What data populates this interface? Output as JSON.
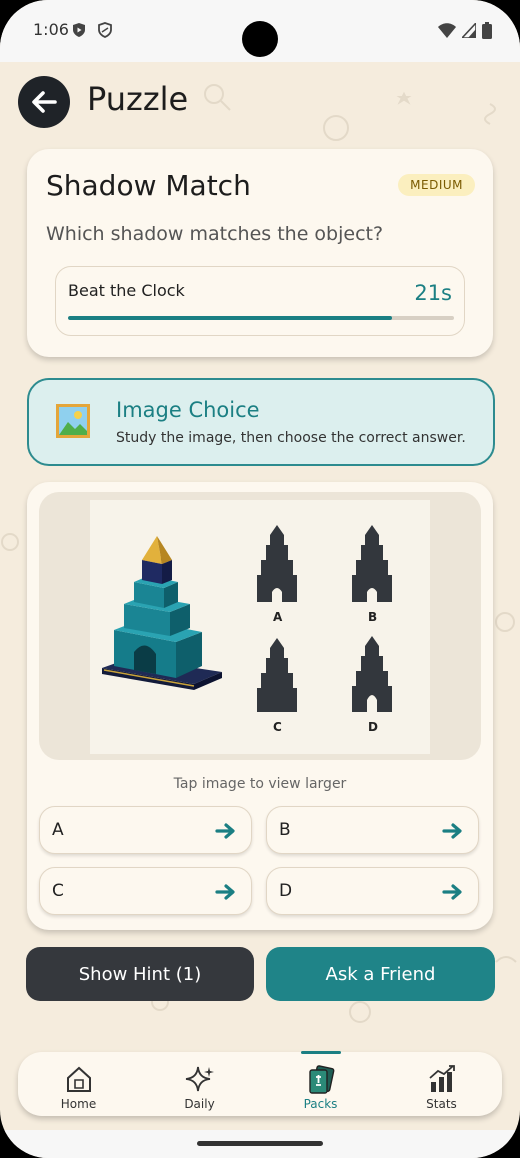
{
  "status": {
    "time": "1:06"
  },
  "header": {
    "title": "Puzzle"
  },
  "puzzle": {
    "title": "Shadow Match",
    "difficulty": "MEDIUM",
    "question": "Which shadow matches the object?"
  },
  "timer": {
    "label": "Beat the Clock",
    "value": "21s",
    "progress": 0.84
  },
  "mode": {
    "icon": "framed-picture-icon",
    "title": "Image Choice",
    "subtitle": "Study the image, then choose the correct answer."
  },
  "image": {
    "hint": "Tap image to view larger",
    "shadow_labels": [
      "A",
      "B",
      "C",
      "D"
    ]
  },
  "answers": [
    "A",
    "B",
    "C",
    "D"
  ],
  "actions": {
    "hint": "Show Hint (1)",
    "friend": "Ask a Friend"
  },
  "nav": [
    {
      "label": "Home",
      "icon": "home-puzzle-icon",
      "active": false
    },
    {
      "label": "Daily",
      "icon": "sparkle-icon",
      "active": false
    },
    {
      "label": "Packs",
      "icon": "cards-icon",
      "active": true
    },
    {
      "label": "Stats",
      "icon": "stats-chart-icon",
      "active": false
    }
  ],
  "colors": {
    "accent": "#1b7f83",
    "background": "#f5ecdd",
    "dark": "#35383d"
  }
}
